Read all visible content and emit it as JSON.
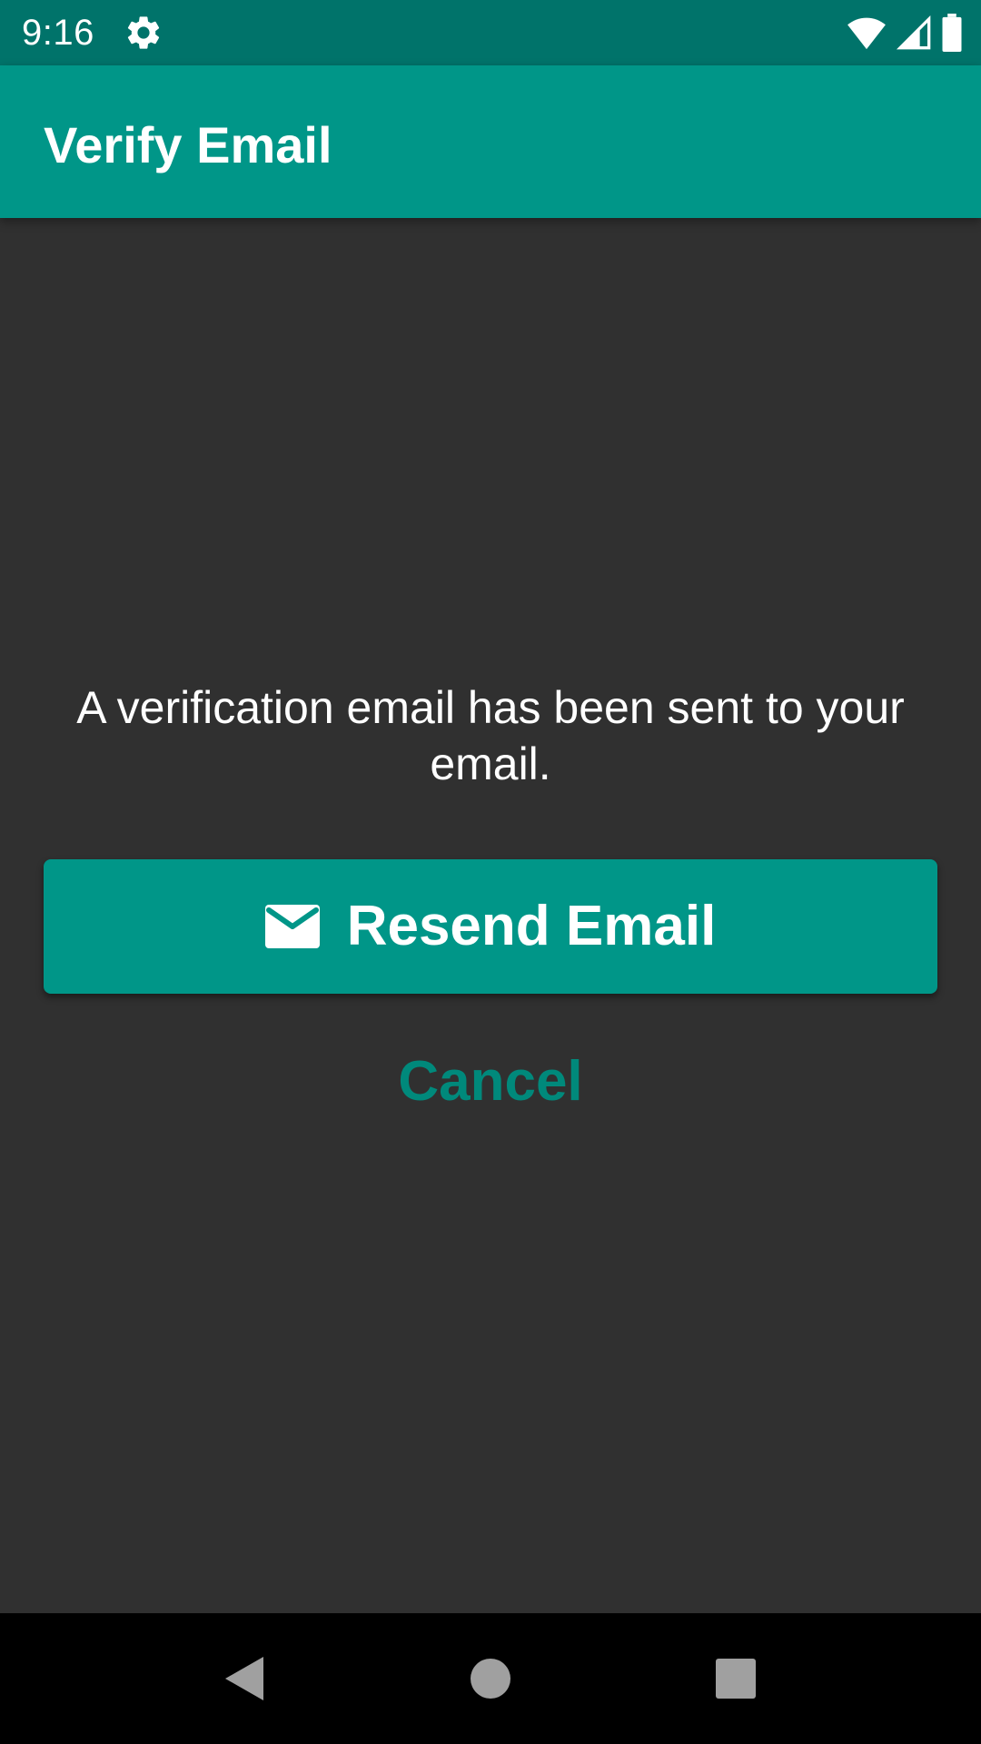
{
  "status_bar": {
    "time": "9:16",
    "icons": [
      "settings-gear-icon",
      "wifi-icon",
      "cell-signal-icon",
      "battery-icon"
    ]
  },
  "app_bar": {
    "title": "Verify Email"
  },
  "main": {
    "message": "A verification email has been sent to your email.",
    "resend_button": {
      "label": "Resend Email",
      "icon": "mail-icon"
    },
    "cancel_button": {
      "label": "Cancel"
    }
  },
  "nav_bar": {
    "buttons": [
      "back",
      "home",
      "recents"
    ]
  },
  "colors": {
    "status_bar": "#00736A",
    "app_bar": "#009688",
    "background": "#303030",
    "accent": "#009688",
    "cancel_text": "#00897B",
    "nav_bar": "#000000"
  }
}
